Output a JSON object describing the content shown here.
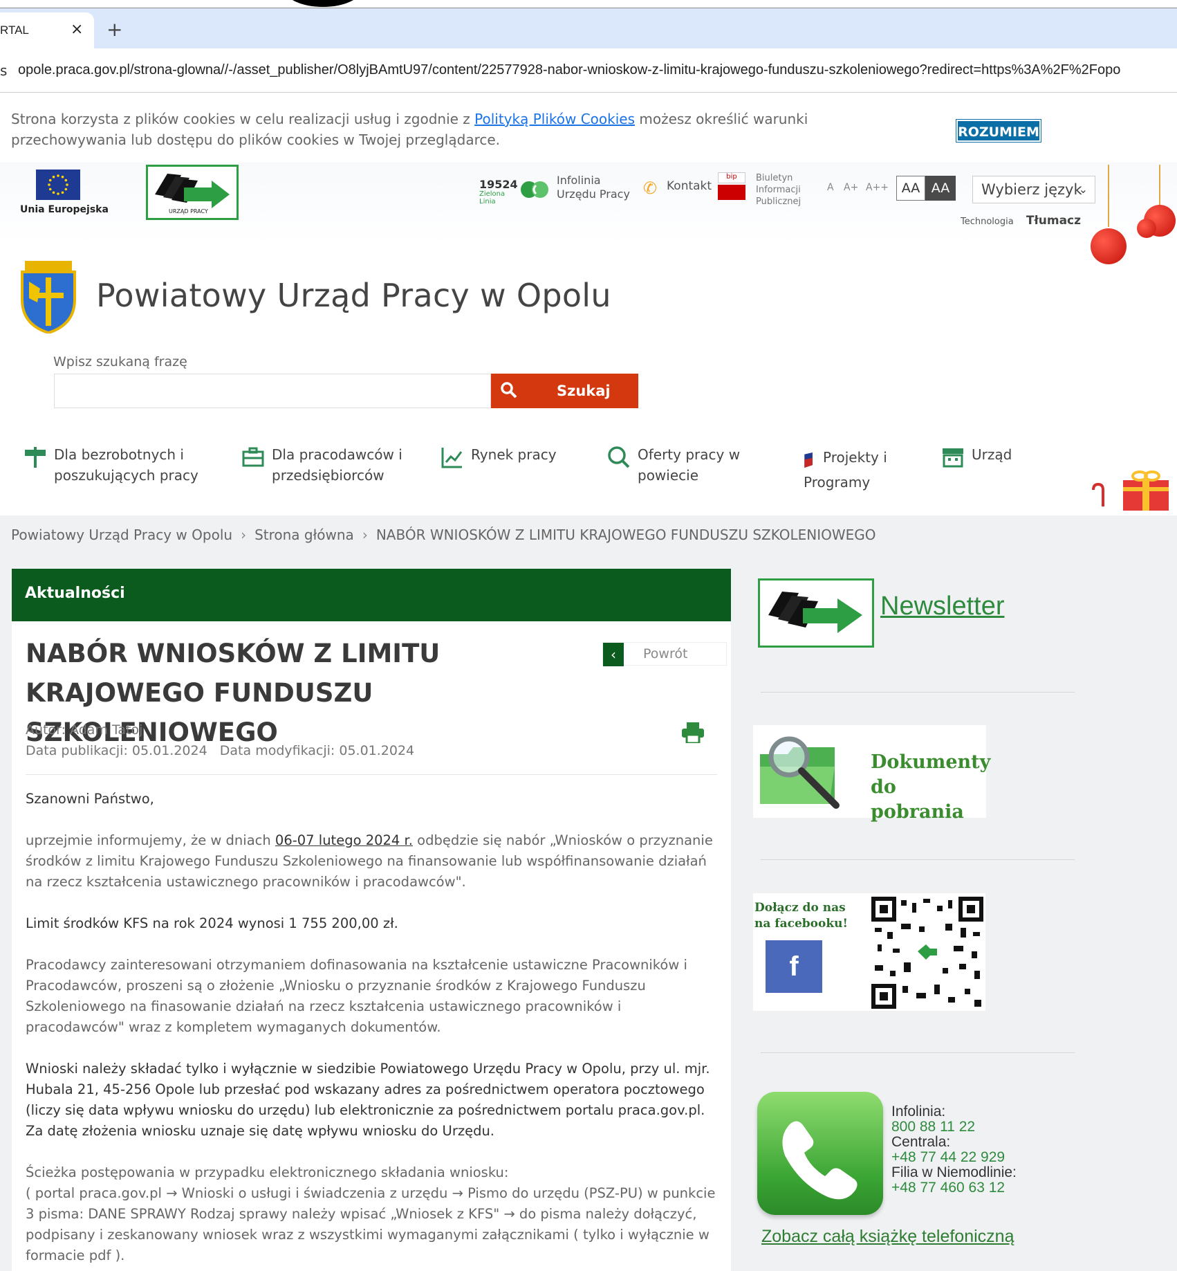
{
  "browser": {
    "tab_title": "RTAL",
    "tab_close": "×",
    "new_tab": "+",
    "url_prefix": "s",
    "url": "opole.praca.gov.pl/strona-glowna//-/asset_publisher/O8lyjBAmtU97/content/22577928-nabor-wnioskow-z-limitu-krajowego-funduszu-szkoleniowego?redirect=https%3A%2F%2Fopo"
  },
  "cookie": {
    "text_before": "Strona korzysta z plików cookies w celu realizacji usług i zgodnie z ",
    "link": "Polityką Plików Cookies",
    "text_after": " możesz określić warunki przechowywania lub dostępu do plików cookies w Twojej przeglądarce.",
    "button": "ROZUMIEM"
  },
  "header": {
    "eu_label": "Unia Europejska",
    "up_logo_label": "URZĄD PRACY",
    "infolinia_number": "19524",
    "infolinia_sub": "Zielona Linia",
    "infolinia_text": "Infolinia Urzędu Pracy",
    "kontakt": "Kontakt",
    "bip_logo": "bip",
    "biuletyn": "Biuletyn Informacji Publicznej",
    "font_small": "A",
    "font_medium": "A+",
    "font_large": "A++",
    "contrast_1": "AA",
    "contrast_2": "AA",
    "language_select": "Wybierz język",
    "translate_tech": "Technologia",
    "translate_label": "Tłumacz"
  },
  "site": {
    "title": "Powiatowy Urząd Pracy w Opolu"
  },
  "search": {
    "label": "Wpisz szukaną frazę",
    "placeholder": "",
    "button": "Szukaj"
  },
  "nav": {
    "items": [
      {
        "line1": "Dla bezrobotnych i",
        "line2": "poszukujących pracy"
      },
      {
        "line1": "Dla pracodawców i",
        "line2": "przedsiębiorców"
      },
      {
        "line1": "Rynek pracy",
        "line2": ""
      },
      {
        "line1": "Oferty pracy w",
        "line2": "powiecie"
      },
      {
        "line1": "Projekty i",
        "line2": "Programy"
      },
      {
        "line1": "Urząd",
        "line2": ""
      }
    ]
  },
  "breadcrumb": {
    "items": [
      "Powiatowy Urząd Pracy w Opolu",
      "Strona główna",
      "NABÓR WNIOSKÓW Z LIMITU KRAJOWEGO FUNDUSZU SZKOLENIOWEGO"
    ],
    "separator": "›"
  },
  "article": {
    "section": "Aktualności",
    "title": "NABÓR WNIOSKÓW Z LIMITU KRAJOWEGO FUNDUSZU SZKOLENIOWEGO",
    "back": "Powrót",
    "author": "Autor: Adam Tatoj",
    "dates": "Data publikacji: 05.01.2024   Data modyfikacji: 05.01.2024",
    "greeting": "Szanowni Państwo,",
    "p1_before": "uprzejmie informujemy, że w dniach ",
    "p1_date": "06-07 lutego 2024 r.",
    "p1_after": " odbędzie się nabór „Wniosków o przyznanie środków z limitu Krajowego Funduszu Szkoleniowego na finansowanie lub współfinansowanie działań na rzecz kształcenia ustawicznego pracowników i pracodawców\".",
    "p2": "Limit środków KFS na rok 2024 wynosi 1 755 200,00 zł.",
    "p3": "Pracodawcy zainteresowani otrzymaniem dofinasowania na kształcenie ustawiczne Pracowników i Pracodawców, proszeni są o złożenie „Wniosku o przyznanie środków z Krajowego Funduszu Szkoleniowego na finasowanie działań na rzecz kształcenia ustawicznego pracowników i pracodawców\" wraz z kompletem wymaganych dokumentów.",
    "p4": "Wnioski  należy składać tylko i wyłącznie w siedzibie Powiatowego Urzędu Pracy w Opolu, przy ul. mjr. Hubala 21, 45-256 Opole lub przesłać pod wskazany adres za pośrednictwem operatora pocztowego (liczy się data wpływu wniosku do urzędu) lub elektronicznie za pośrednictwem portalu praca.gov.pl.  Za datę złożenia wniosku uznaje się datę wpływu wniosku do Urzędu.",
    "p5_1": "Ścieżka postępowania w przypadku elektronicznego składania wniosku:",
    "p5_2": "( portal praca.gov.pl → Wnioski o usługi i świadczenia z urzędu → Pismo do urzędu (PSZ-PU) w punkcie 3 pisma: DANE SPRAWY Rodzaj sprawy należy wpisać „Wniosek z KFS\" → do pisma należy dołączyć, podpisany i zeskanowany wniosek wraz z wszystkimi wymaganymi załącznikami ( tylko i wyłącznie w formacie pdf )."
  },
  "sidebar": {
    "newsletter": "Newsletter",
    "docs_line1": "Dokumenty",
    "docs_line2": "do pobrania",
    "fb_line1": "Dołącz do nas",
    "fb_line2": "na facebooku!",
    "fb_letter": "f",
    "contacts": [
      {
        "label": "Infolinia:",
        "value": "800 88 11 22"
      },
      {
        "label": "Centrala:",
        "value": "+48 77 44 22 929"
      },
      {
        "label": "Filia w Niemodlinie:",
        "value": "+48 77 460 63 12"
      }
    ],
    "phonebook": "Zobacz całą książkę telefoniczną"
  },
  "colors": {
    "brand_green": "#0b5a1e",
    "search_button": "#d3380f",
    "cookie_button": "#0a6fa6"
  }
}
